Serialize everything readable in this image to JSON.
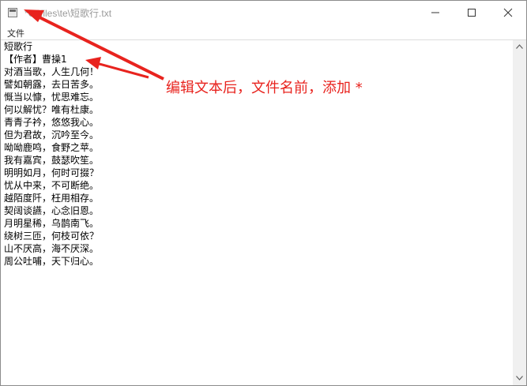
{
  "window": {
    "title": "*C:\\files\\te\\短歌行.txt",
    "controls": [
      "minimize",
      "maximize",
      "close"
    ]
  },
  "menu": {
    "items": [
      {
        "label": "文件"
      }
    ]
  },
  "editor": {
    "lines": [
      "短歌行",
      "【作者】曹操1",
      "对酒当歌，人生几何！",
      "譬如朝露，去日苦多。",
      "慨当以慷，忧思难忘。",
      "何以解忧？唯有杜康。",
      "青青子衿，悠悠我心。",
      "但为君故，沉吟至今。",
      "呦呦鹿鸣，食野之苹。",
      "我有嘉宾，鼓瑟吹笙。",
      "明明如月，何时可掇？",
      "忧从中来，不可断绝。",
      "越陌度阡，枉用相存。",
      "契阔谈讌，心念旧恩。",
      "月明星稀，乌鹊南飞。",
      "绕树三匝，何枝可依？",
      "山不厌高，海不厌深。",
      "周公吐哺，天下归心。"
    ]
  },
  "annotation": {
    "text": "编辑文本后，文件名前，添加 *",
    "color": "#e8231e"
  }
}
